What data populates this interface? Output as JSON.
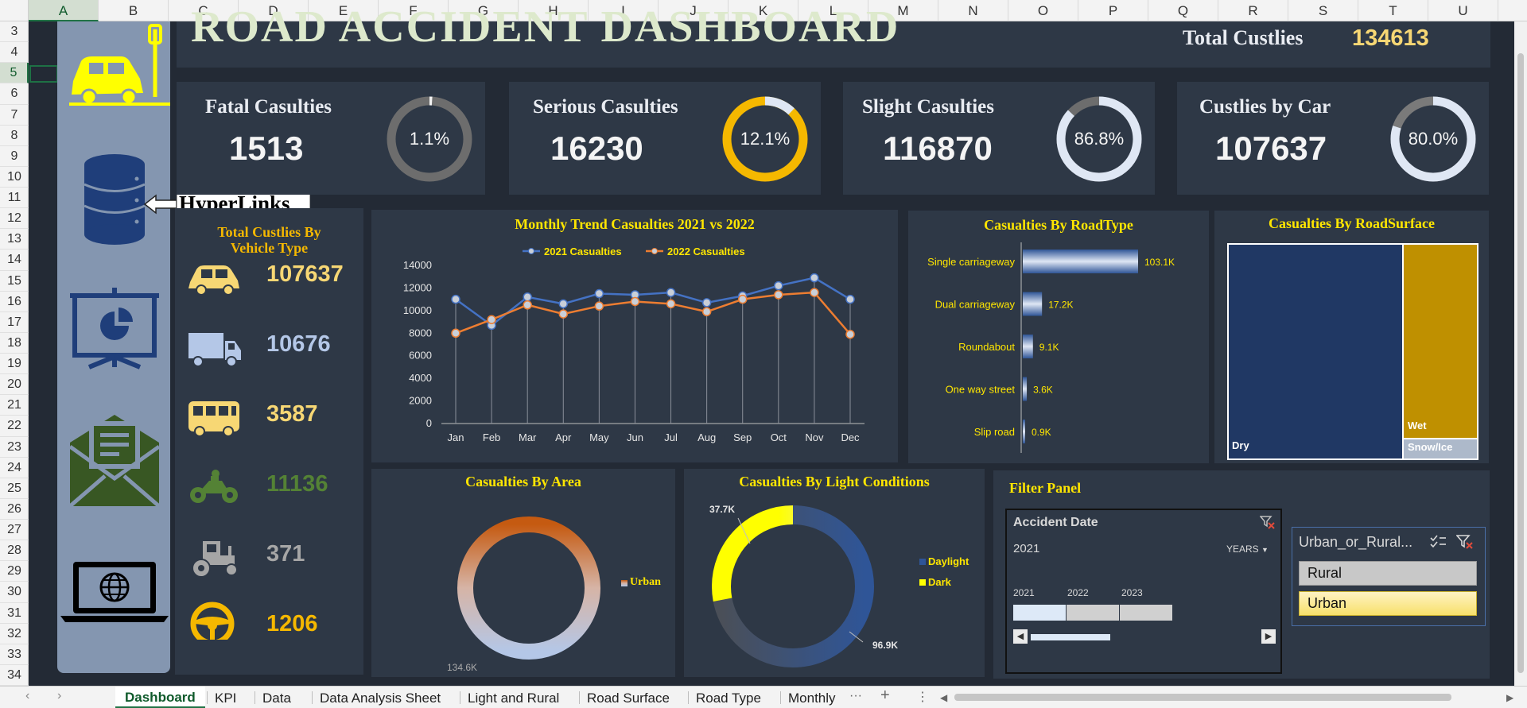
{
  "spreadsheet": {
    "columns": [
      "A",
      "B",
      "C",
      "D",
      "E",
      "F",
      "G",
      "H",
      "I",
      "J",
      "K",
      "L",
      "M",
      "N",
      "O",
      "P",
      "Q",
      "R",
      "S",
      "T",
      "U"
    ],
    "rows": [
      "3",
      "4",
      "5",
      "6",
      "7",
      "8",
      "9",
      "10",
      "11",
      "12",
      "13",
      "14",
      "15",
      "16",
      "17",
      "18",
      "19",
      "20",
      "21",
      "22",
      "23",
      "24",
      "25",
      "26",
      "27",
      "28",
      "29",
      "30",
      "31",
      "32",
      "33",
      "34"
    ],
    "selected_column": "A",
    "selected_row": "5",
    "sheet_tabs": [
      "Dashboard",
      "KPI",
      "Data",
      "Data Analysis Sheet",
      "Light and Rural",
      "Road Surface",
      "Road Type",
      "Monthly"
    ],
    "active_tab": "Dashboard",
    "more_tabs": "···",
    "add_sheet": "+"
  },
  "header": {
    "title": "ROAD ACCIDENT DASHBOARD",
    "total_label": "Total Custlies",
    "total_value": "134613"
  },
  "kpis": [
    {
      "label": "Fatal Casulties",
      "value": "1513",
      "pct_label": "1.1%",
      "pct": 1.1,
      "color": "#f2f2f2",
      "track": "#6d6d6d"
    },
    {
      "label": "Serious Casulties",
      "value": "16230",
      "pct_label": "12.1%",
      "pct": 12.1,
      "color": "#dfe7f4",
      "track": "#f5b800"
    },
    {
      "label": "Slight Casulties",
      "value": "116870",
      "pct_label": "86.8%",
      "pct": 86.8,
      "color": "#dfe7f4",
      "track": "#6d6d6d"
    },
    {
      "label": "Custlies by Car",
      "value": "107637",
      "pct_label": "80.0%",
      "pct": 80.0,
      "color": "#dfe7f4",
      "track": "#7a7a7a"
    }
  ],
  "hyperlinks_label": "HyperLinks",
  "sidebar_icons": [
    "car-crash-icon",
    "database-icon",
    "presentation-icon",
    "email-icon",
    "laptop-globe-icon"
  ],
  "vehicle_panel": {
    "title_line1": "Total Custlies By",
    "title_line2": "Vehicle Type",
    "items": [
      {
        "icon": "car-icon",
        "value": "107637",
        "color": "#f7d774"
      },
      {
        "icon": "truck-icon",
        "value": "10676",
        "color": "#b4c7e7"
      },
      {
        "icon": "bus-icon",
        "value": "3587",
        "color": "#f7d774"
      },
      {
        "icon": "motorcycle-icon",
        "value": "11136",
        "color": "#548235"
      },
      {
        "icon": "tractor-icon",
        "value": "371",
        "color": "#a6a6a6"
      },
      {
        "icon": "steering-wheel-icon",
        "value": "1206",
        "color": "#f5b800"
      }
    ]
  },
  "filter_panel": {
    "title": "Filter Panel",
    "date_slicer_title": "Accident Date",
    "date_selected": "2021",
    "period": "YEARS",
    "years": [
      "2021",
      "2022",
      "2023"
    ],
    "area_slicer_title": "Urban_or_Rural...",
    "area_options": [
      "Rural",
      "Urban"
    ]
  },
  "chart_data": [
    {
      "type": "line",
      "title": "Monthly Trend Casualties 2021 vs 2022",
      "categories": [
        "Jan",
        "Feb",
        "Mar",
        "Apr",
        "May",
        "Jun",
        "Jul",
        "Aug",
        "Sep",
        "Oct",
        "Nov",
        "Dec"
      ],
      "series": [
        {
          "name": "2021 Casualties",
          "color": "#4472c4",
          "values": [
            11000,
            8700,
            11200,
            10600,
            11500,
            11400,
            11600,
            10700,
            11300,
            12200,
            12900,
            11000
          ]
        },
        {
          "name": "2022 Casualties",
          "color": "#ed7d31",
          "values": [
            8000,
            9200,
            10500,
            9700,
            10400,
            10800,
            10600,
            9900,
            11000,
            11400,
            11600,
            7900
          ]
        }
      ],
      "yticks": [
        "0",
        "2000",
        "4000",
        "6000",
        "8000",
        "10000",
        "12000",
        "14000"
      ],
      "ylim": [
        0,
        14000
      ],
      "legend": "top"
    },
    {
      "type": "bar",
      "title": "Casualties By RoadType",
      "categories": [
        "Single carriageway",
        "Dual carriageway",
        "Roundabout",
        "One way street",
        "Slip road"
      ],
      "values": [
        103.1,
        17.2,
        9.1,
        3.6,
        0.9
      ],
      "labels": [
        "103.1K",
        "17.2K",
        "9.1K",
        "3.6K",
        "0.9K"
      ],
      "unit": "K"
    },
    {
      "type": "treemap",
      "title": "Casualties By RoadSurface",
      "categories": [
        "Dry",
        "Wet",
        "Snow/Ice"
      ],
      "colors": [
        "#203864",
        "#bf9000",
        "#adb9ca"
      ]
    },
    {
      "type": "pie",
      "title": "Casualties By Area",
      "legend": [
        "Urban"
      ],
      "label": "134.6K"
    },
    {
      "type": "pie",
      "title": "Casualties By Light Conditions",
      "categories": [
        "Daylight",
        "Dark"
      ],
      "values": [
        96.9,
        37.7
      ],
      "labels": [
        "96.9K",
        "37.7K"
      ],
      "colors": [
        "#2f5597",
        "#ffff00"
      ]
    }
  ]
}
